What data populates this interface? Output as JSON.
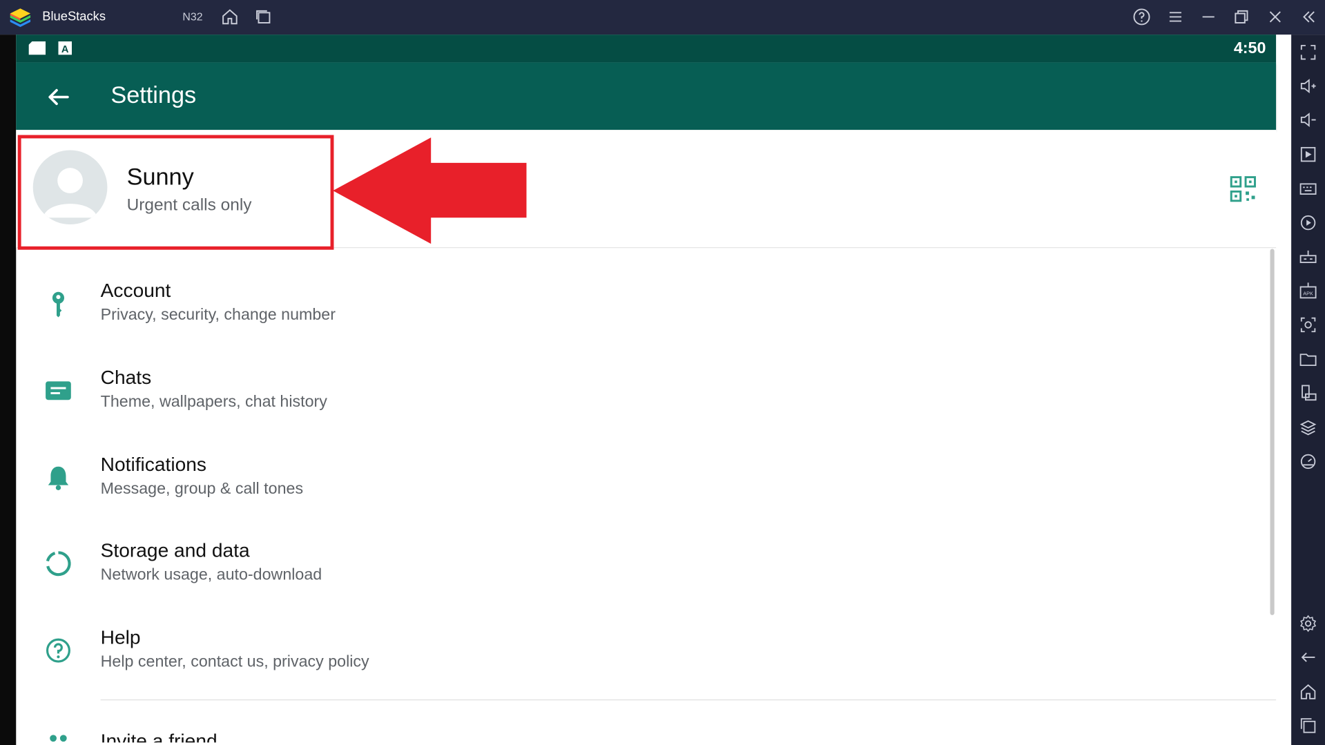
{
  "window": {
    "app_title": "BlueStacks",
    "instance": "N32"
  },
  "status_bar": {
    "time": "4:50"
  },
  "app_bar": {
    "title": "Settings"
  },
  "profile": {
    "name": "Sunny",
    "status": "Urgent calls only"
  },
  "settings": [
    {
      "title": "Account",
      "subtitle": "Privacy, security, change number",
      "icon": "key-icon"
    },
    {
      "title": "Chats",
      "subtitle": "Theme, wallpapers, chat history",
      "icon": "chat-icon"
    },
    {
      "title": "Notifications",
      "subtitle": "Message, group & call tones",
      "icon": "bell-icon"
    },
    {
      "title": "Storage and data",
      "subtitle": "Network usage, auto-download",
      "icon": "storage-icon"
    },
    {
      "title": "Help",
      "subtitle": "Help center, contact us, privacy policy",
      "icon": "help-icon"
    },
    {
      "title": "Invite a friend",
      "subtitle": "",
      "icon": "invite-icon"
    }
  ],
  "colors": {
    "titlebar": "#232840",
    "status_bar": "#054d44",
    "app_bar": "#075e54",
    "icon_accent": "#2fa08b",
    "highlight": "#e8202a"
  }
}
